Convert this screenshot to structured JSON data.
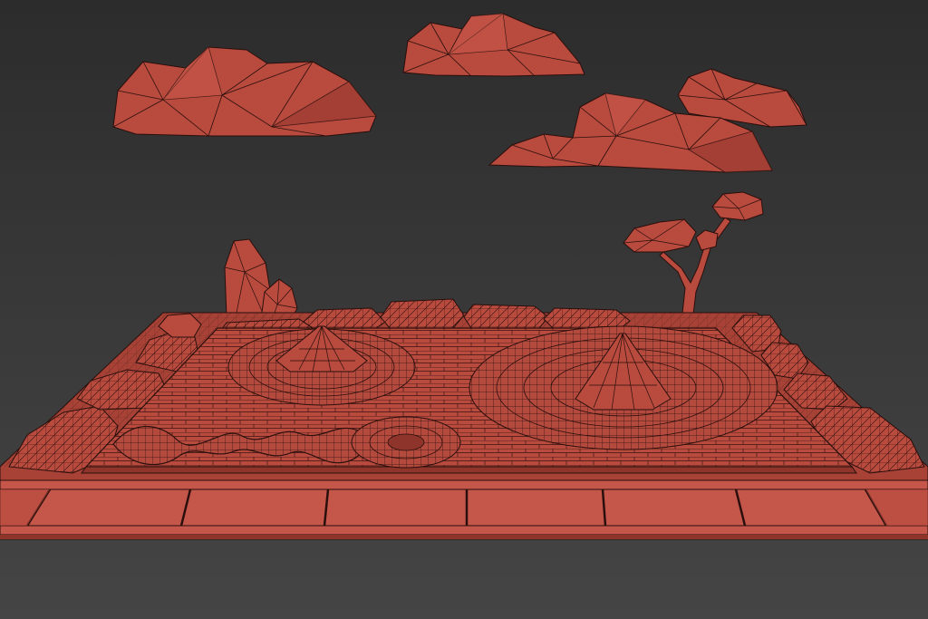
{
  "scene": {
    "background_color": "#3a3a3a",
    "mesh_fill_color": "#b84a3e",
    "mesh_light_color": "#c9584a",
    "mesh_dark_color": "#8e342b",
    "wireframe_color": "#2a0f0c",
    "objects": [
      "cloud-left",
      "cloud-top-center",
      "cloud-right",
      "bonsai-tree",
      "standing-rocks",
      "zen-garden-base",
      "raked-gravel-bed",
      "small-raked-cone",
      "large-raked-cone",
      "serpentine-rake-pattern",
      "border-rocks",
      "stone-path-tiles"
    ]
  }
}
